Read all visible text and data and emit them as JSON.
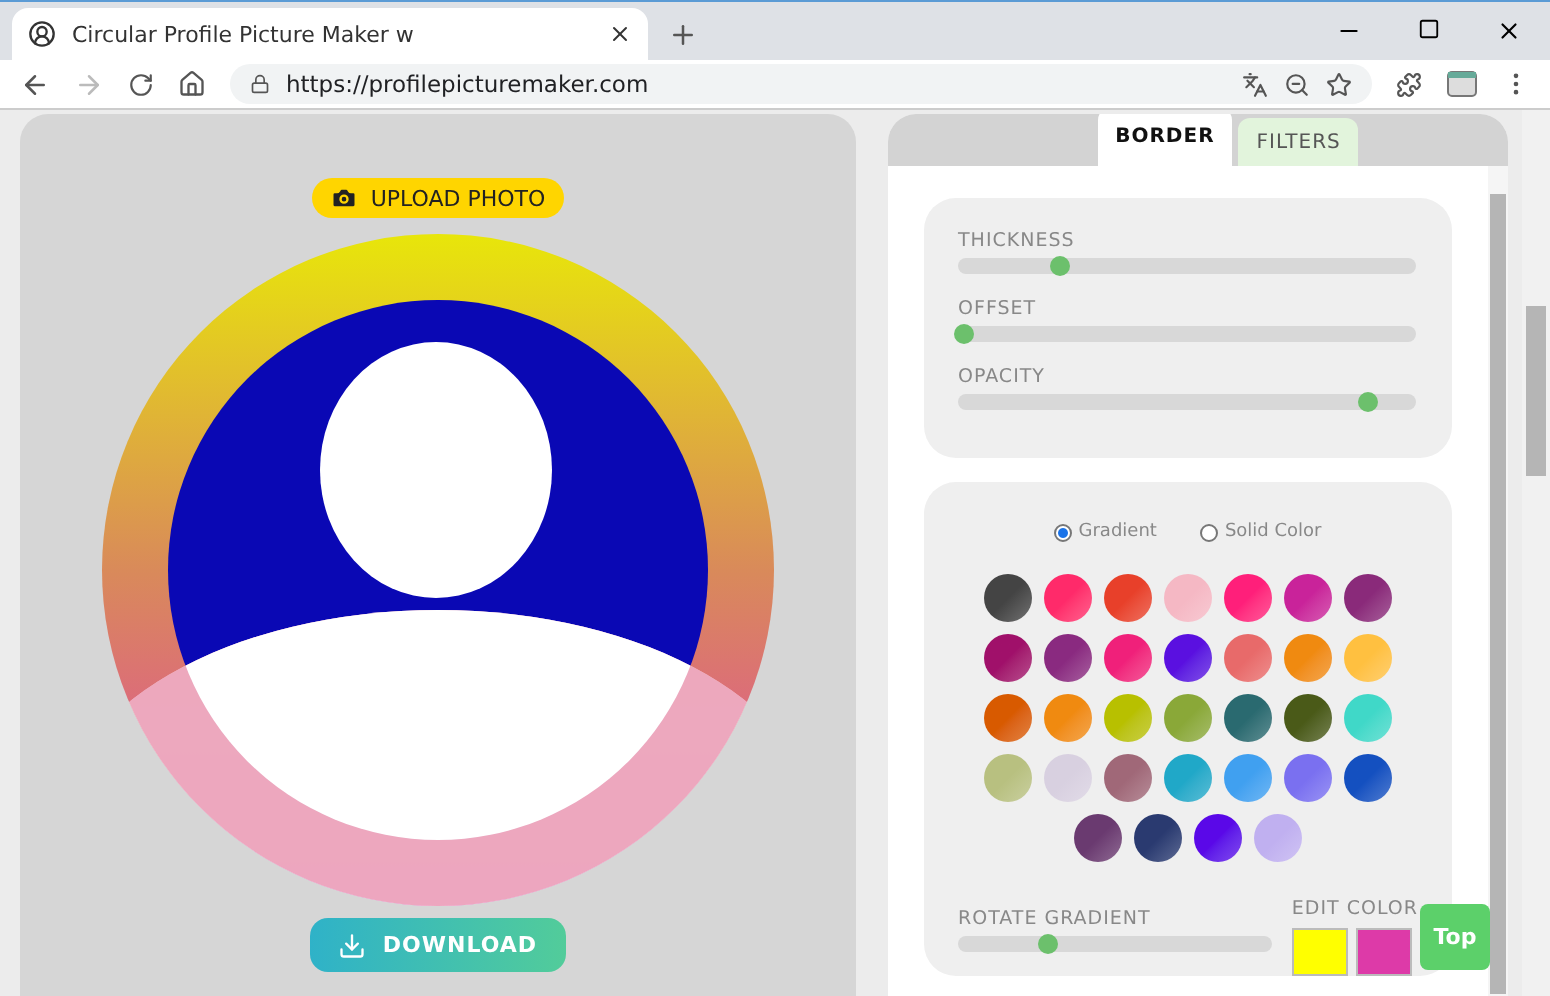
{
  "browser": {
    "tab_title": "Circular Profile Picture Maker w",
    "url": "https://profilepicturemaker.com"
  },
  "upload_button": "UPLOAD PHOTO",
  "download_button": "DOWNLOAD",
  "tabs": [
    {
      "label": "BORDER",
      "selected": true
    },
    {
      "label": "FILTERS",
      "selected": false
    }
  ],
  "sliders": [
    {
      "label": "THICKNESS",
      "level": 0.21
    },
    {
      "label": "OFFSET",
      "level": 0.0
    },
    {
      "label": "OPACITY",
      "level": 0.88
    }
  ],
  "fill_options": [
    {
      "label": "Gradient",
      "selected": true
    },
    {
      "label": "Solid Color",
      "selected": false
    }
  ],
  "swatches": [
    {
      "color": "#444444"
    },
    {
      "color": "#ff2a6a"
    },
    {
      "color": "#e8402a"
    },
    {
      "color": "#f5b8c4"
    },
    {
      "color": "#ff1f7a"
    },
    {
      "color": "#c9239a"
    },
    {
      "color": "#8a2a7a"
    },
    {
      "color": "#a0106a"
    },
    {
      "color": "#8a2a80"
    },
    {
      "color": "#f0207a"
    },
    {
      "color": "#5a10e0"
    },
    {
      "color": "#e86a6a"
    },
    {
      "color": "#f08a10"
    },
    {
      "color": "#ffc040"
    },
    {
      "color": "#d85a00"
    },
    {
      "color": "#f08a10"
    },
    {
      "color": "#b8c000"
    },
    {
      "color": "#8aa838"
    },
    {
      "color": "#2a6a70"
    },
    {
      "color": "#4a5a18"
    },
    {
      "color": "#40d8c8"
    },
    {
      "color": "#b8c080"
    },
    {
      "color": "#d8d0e0"
    },
    {
      "color": "#a06878"
    },
    {
      "color": "#20a8c8"
    },
    {
      "color": "#40a0f0"
    },
    {
      "color": "#7a70f0"
    },
    {
      "color": "#1450c0"
    },
    {
      "color": "#6a3a70"
    },
    {
      "color": "#2a3a70"
    },
    {
      "color": "#5a08e8"
    },
    {
      "color": "#c0b0f0"
    }
  ],
  "rotate_gradient": {
    "label": "ROTATE GRADIENT",
    "level": 0.27
  },
  "edit_color": {
    "label": "EDIT COLOR",
    "swatches": [
      {
        "color": "#ffff00"
      },
      {
        "color": "#dd3aa8"
      }
    ]
  },
  "top_button": "Top"
}
